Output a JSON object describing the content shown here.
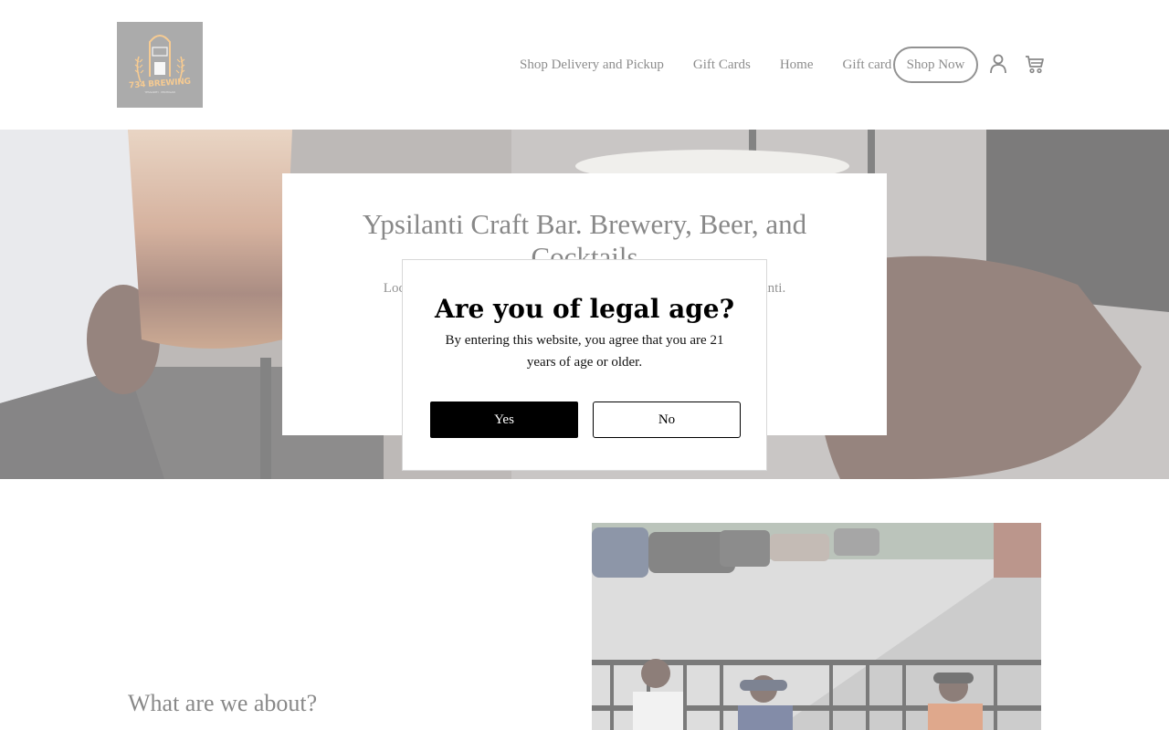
{
  "header": {
    "logo": {
      "brand": "734 BREWING",
      "tagline": "YPSILANTI · MICHIGAN",
      "icon": "brewery-logo"
    },
    "nav": [
      {
        "label": "Shop Delivery and Pickup"
      },
      {
        "label": "Gift Cards"
      },
      {
        "label": "Home"
      },
      {
        "label": "Gift card"
      }
    ],
    "shop_now_label": "Shop Now",
    "account_icon": "person-icon",
    "cart_icon": "cart-icon"
  },
  "hero": {
    "title": "Ypsilanti Craft Bar. Brewery, Beer, and Cocktails",
    "subtitle_visible_left": "Loca",
    "subtitle_visible_right": "lanti."
  },
  "about": {
    "title": "What are we about?"
  },
  "age_gate": {
    "title": "Are you of legal age?",
    "message": "By entering this website, you agree that you are 21 years of age or older.",
    "yes_label": "Yes",
    "no_label": "No"
  },
  "colors": {
    "overlay": "rgba(255,255,255,0.42)",
    "logo_bg": "#6e6e6e",
    "logo_accent": "#f0a544",
    "yes_button_bg": "#000000"
  }
}
